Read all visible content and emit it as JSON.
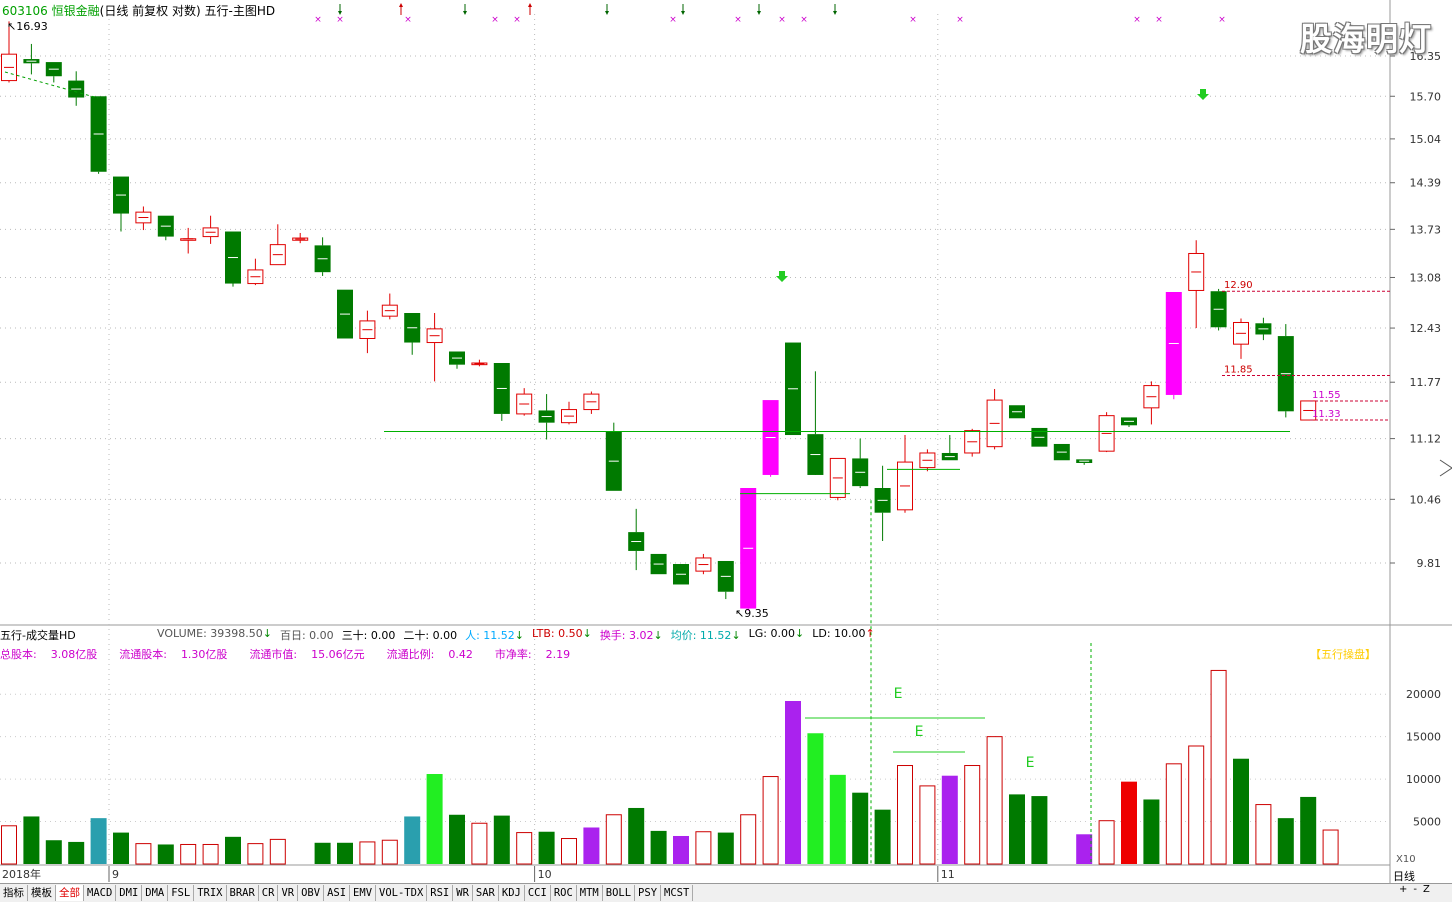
{
  "header": {
    "stock_code": "603106",
    "stock_name": "恒银金融",
    "mode": "(日线 前复权 对数)",
    "indicator": "五行-主图HD"
  },
  "watermark": "股海明灯",
  "price_axis": {
    "ticks": [
      "16.35",
      "15.70",
      "15.04",
      "14.39",
      "13.73",
      "13.08",
      "12.43",
      "11.77",
      "11.12",
      "10.46",
      "9.81"
    ],
    "log_scale": true
  },
  "markers": {
    "high_label": "16.93",
    "low_label": "9.35",
    "levels": [
      "12.90",
      "11.85",
      "11.55",
      "11.33"
    ]
  },
  "candles": [
    {
      "o": 15.95,
      "h": 16.93,
      "l": 15.92,
      "c": 16.38
    },
    {
      "o": 16.3,
      "h": 16.55,
      "l": 16.05,
      "c": 16.23
    },
    {
      "o": 16.25,
      "h": 16.25,
      "l": 15.92,
      "c": 16.02
    },
    {
      "o": 15.95,
      "h": 16.1,
      "l": 15.55,
      "c": 15.68
    },
    {
      "o": 15.7,
      "h": 15.7,
      "l": 14.52,
      "c": 14.55
    },
    {
      "o": 14.48,
      "h": 14.48,
      "l": 13.7,
      "c": 13.95
    },
    {
      "o": 13.82,
      "h": 14.05,
      "l": 13.72,
      "c": 13.97
    },
    {
      "o": 13.92,
      "h": 13.92,
      "l": 13.58,
      "c": 13.63
    },
    {
      "o": 13.6,
      "h": 13.75,
      "l": 13.4,
      "c": 13.6
    },
    {
      "o": 13.63,
      "h": 13.92,
      "l": 13.53,
      "c": 13.75
    },
    {
      "o": 13.7,
      "h": 13.7,
      "l": 12.96,
      "c": 13.0
    },
    {
      "o": 13.0,
      "h": 13.33,
      "l": 12.98,
      "c": 13.18
    },
    {
      "o": 13.25,
      "h": 13.8,
      "l": 13.25,
      "c": 13.52
    },
    {
      "o": 13.58,
      "h": 13.68,
      "l": 13.54,
      "c": 13.61
    },
    {
      "o": 13.51,
      "h": 13.62,
      "l": 13.1,
      "c": 13.15
    },
    {
      "o": 12.92,
      "h": 12.92,
      "l": 12.3,
      "c": 12.3
    },
    {
      "o": 12.3,
      "h": 12.65,
      "l": 12.12,
      "c": 12.52
    },
    {
      "o": 12.58,
      "h": 12.87,
      "l": 12.54,
      "c": 12.72
    },
    {
      "o": 12.62,
      "h": 12.62,
      "l": 12.1,
      "c": 12.25
    },
    {
      "o": 12.25,
      "h": 12.62,
      "l": 11.78,
      "c": 12.42
    },
    {
      "o": 12.14,
      "h": 12.14,
      "l": 11.93,
      "c": 11.98
    },
    {
      "o": 11.98,
      "h": 12.04,
      "l": 11.96,
      "c": 12.0
    },
    {
      "o": 12.0,
      "h": 12.0,
      "l": 11.32,
      "c": 11.4
    },
    {
      "o": 11.4,
      "h": 11.7,
      "l": 11.38,
      "c": 11.63
    },
    {
      "o": 11.44,
      "h": 11.63,
      "l": 11.11,
      "c": 11.3
    },
    {
      "o": 11.3,
      "h": 11.54,
      "l": 11.28,
      "c": 11.45
    },
    {
      "o": 11.45,
      "h": 11.66,
      "l": 11.4,
      "c": 11.63
    },
    {
      "o": 11.2,
      "h": 11.3,
      "l": 10.55,
      "c": 10.55
    },
    {
      "o": 10.12,
      "h": 10.36,
      "l": 9.74,
      "c": 9.93
    },
    {
      "o": 9.9,
      "h": 9.9,
      "l": 9.7,
      "c": 9.7
    },
    {
      "o": 9.8,
      "h": 9.8,
      "l": 9.6,
      "c": 9.6
    },
    {
      "o": 9.73,
      "h": 9.9,
      "l": 9.7,
      "c": 9.86
    },
    {
      "o": 9.83,
      "h": 9.83,
      "l": 9.46,
      "c": 9.53
    },
    {
      "o": 9.37,
      "h": 10.58,
      "l": 9.35,
      "c": 10.58,
      "color": "#ff00ff"
    },
    {
      "o": 10.72,
      "h": 11.56,
      "l": 10.7,
      "c": 11.56,
      "color": "#ff00ff"
    },
    {
      "o": 12.25,
      "h": 12.25,
      "l": 11.16,
      "c": 11.16
    },
    {
      "o": 11.17,
      "h": 11.9,
      "l": 10.8,
      "c": 10.72
    },
    {
      "o": 10.48,
      "h": 10.9,
      "l": 10.45,
      "c": 10.9
    },
    {
      "o": 10.9,
      "h": 11.12,
      "l": 10.58,
      "c": 10.6
    },
    {
      "o": 10.58,
      "h": 10.82,
      "l": 10.03,
      "c": 10.32
    },
    {
      "o": 10.35,
      "h": 11.16,
      "l": 10.32,
      "c": 10.86
    },
    {
      "o": 10.8,
      "h": 11.0,
      "l": 10.76,
      "c": 10.96
    },
    {
      "o": 10.96,
      "h": 11.16,
      "l": 10.88,
      "c": 10.88
    },
    {
      "o": 10.96,
      "h": 11.23,
      "l": 10.92,
      "c": 11.21
    },
    {
      "o": 11.03,
      "h": 11.69,
      "l": 11.0,
      "c": 11.56
    },
    {
      "o": 11.5,
      "h": 11.5,
      "l": 11.35,
      "c": 11.35
    },
    {
      "o": 11.24,
      "h": 11.24,
      "l": 11.03,
      "c": 11.03
    },
    {
      "o": 11.06,
      "h": 11.06,
      "l": 10.88,
      "c": 10.88
    },
    {
      "o": 10.89,
      "h": 10.89,
      "l": 10.83,
      "c": 10.85
    },
    {
      "o": 10.98,
      "h": 11.42,
      "l": 10.97,
      "c": 11.38
    },
    {
      "o": 11.36,
      "h": 11.36,
      "l": 11.25,
      "c": 11.27
    },
    {
      "o": 11.47,
      "h": 11.78,
      "l": 11.28,
      "c": 11.73
    },
    {
      "o": 11.62,
      "h": 12.89,
      "l": 11.57,
      "c": 12.89,
      "color": "#ff00ff"
    },
    {
      "o": 12.91,
      "h": 13.58,
      "l": 12.43,
      "c": 13.4
    },
    {
      "o": 12.9,
      "h": 12.93,
      "l": 12.4,
      "c": 12.44
    },
    {
      "o": 12.23,
      "h": 12.55,
      "l": 12.05,
      "c": 12.5
    },
    {
      "o": 12.49,
      "h": 12.56,
      "l": 12.28,
      "c": 12.35
    },
    {
      "o": 12.33,
      "h": 12.48,
      "l": 11.36,
      "c": 11.43
    },
    {
      "o": 11.33,
      "h": 11.55,
      "l": 11.33,
      "c": 11.55
    }
  ],
  "volume_panel": {
    "title": "五行-成交量HD",
    "readouts": [
      {
        "label": "VOLUME: 39398.50",
        "arrow": "↓",
        "color": "#555555"
      },
      {
        "label": "百日: 0.00",
        "arrow": "",
        "color": "#555555"
      },
      {
        "label": "三十: 0.00",
        "arrow": "",
        "color": "#000000"
      },
      {
        "label": "二十: 0.00",
        "arrow": "",
        "color": "#000000"
      },
      {
        "label": "人: 11.52",
        "arrow": "↓",
        "color": "#00aaff"
      },
      {
        "label": "LTB: 0.50",
        "arrow": "↓",
        "color": "#cc0000"
      },
      {
        "label": "换手: 3.02",
        "arrow": "↓",
        "color": "#cc00cc"
      },
      {
        "label": "均价: 11.52",
        "arrow": "↓",
        "color": "#00aaaa"
      },
      {
        "label": "LG: 0.00",
        "arrow": "↓",
        "color": "#000000"
      },
      {
        "label": "LD: 10.00",
        "arrow": "↑",
        "color": "#000000"
      }
    ],
    "info": [
      {
        "label": "总股本:",
        "value": "3.08亿股"
      },
      {
        "label": "流通股本:",
        "value": "1.30亿股"
      },
      {
        "label": "流通市值:",
        "value": "15.06亿元"
      },
      {
        "label": "流通比例:",
        "value": "0.42"
      },
      {
        "label": "市净率:",
        "value": "2.19"
      }
    ],
    "tag": "【五行操盘】",
    "axis_ticks": [
      "20000",
      "15000",
      "10000",
      "5000"
    ],
    "unit": "X10",
    "e_labels": [
      "E",
      "E",
      "E"
    ],
    "bars": [
      4500,
      5600,
      2800,
      2600,
      5400,
      3700,
      2400,
      2300,
      2300,
      2300,
      3200,
      2400,
      2900,
      0,
      2500,
      2500,
      2600,
      2800,
      5600,
      10600,
      5800,
      4800,
      5700,
      3700,
      3800,
      3000,
      4300,
      5800,
      6600,
      3900,
      3300,
      3800,
      3700,
      5800,
      10300,
      19200,
      15400,
      10500,
      8400,
      6400,
      11600,
      9200,
      10400,
      11600,
      15000,
      8200,
      8000,
      0,
      3500,
      5100,
      9700,
      7600,
      11800,
      13900,
      22800,
      12400,
      7000,
      5400,
      7900,
      4000
    ]
  },
  "volume_colors": [
    "outline",
    "green",
    "green",
    "green",
    "teal",
    "green",
    "outline",
    "green",
    "outline",
    "outline",
    "green",
    "outline",
    "outline",
    "none",
    "green",
    "green",
    "outline",
    "outline",
    "teal",
    "lime",
    "green",
    "outline",
    "green",
    "outline",
    "green",
    "outline",
    "purple",
    "outline",
    "green",
    "green",
    "purple",
    "outline",
    "green",
    "outline",
    "outline",
    "purple",
    "lime",
    "lime",
    "green",
    "green",
    "outline",
    "outline",
    "purple",
    "outline",
    "outline",
    "green",
    "green",
    "none",
    "purple",
    "outline",
    "red",
    "green",
    "outline",
    "outline",
    "outline",
    "green",
    "outline",
    "green",
    "green",
    "outline"
  ],
  "date_axis": {
    "year": "2018年",
    "months": [
      "9",
      "10",
      "11"
    ]
  },
  "tabs": [
    "指标",
    "模板",
    "全部",
    "MACD",
    "DMI",
    "DMA",
    "FSL",
    "TRIX",
    "BRAR",
    "CR",
    "VR",
    "OBV",
    "ASI",
    "EMV",
    "VOL-TDX",
    "RSI",
    "WR",
    "SAR",
    "KDJ",
    "CCI",
    "ROC",
    "MTM",
    "BOLL",
    "PSY",
    "MCST"
  ],
  "active_tab": "全部",
  "period_label": "日线",
  "nav_buttons": [
    "+",
    "-",
    "Z"
  ]
}
